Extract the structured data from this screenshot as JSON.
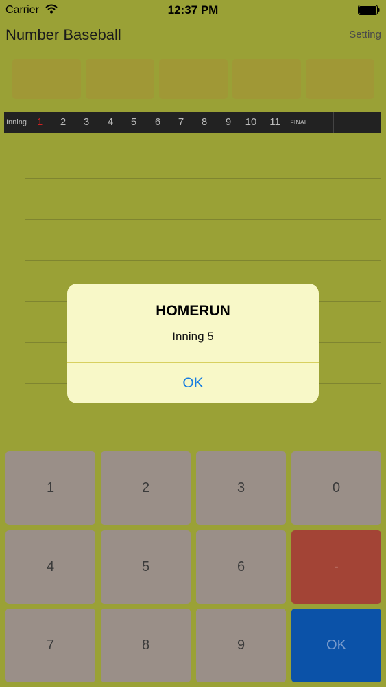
{
  "status_bar": {
    "carrier": "Carrier",
    "time": "12:37 PM"
  },
  "header": {
    "title": "Number Baseball",
    "setting_label": "Setting"
  },
  "scoreboard": {
    "label": "Inning",
    "innings": [
      "1",
      "2",
      "3",
      "4",
      "5",
      "6",
      "7",
      "8",
      "9",
      "10",
      "11"
    ],
    "current_inning": "1",
    "final_label": "FINAL"
  },
  "alert": {
    "title": "HOMERUN",
    "message": "Inning 5",
    "button": "OK"
  },
  "keypad": {
    "keys": [
      "1",
      "2",
      "3",
      "0",
      "4",
      "5",
      "6",
      "-",
      "7",
      "8",
      "9",
      "OK"
    ]
  },
  "colors": {
    "background": "#9aa136",
    "alert_background": "#f8f8c8",
    "minus_key": "#a34436",
    "ok_key": "#0b52a8",
    "digit_key": "#9a8f88",
    "accent": "#1a7ee0"
  }
}
